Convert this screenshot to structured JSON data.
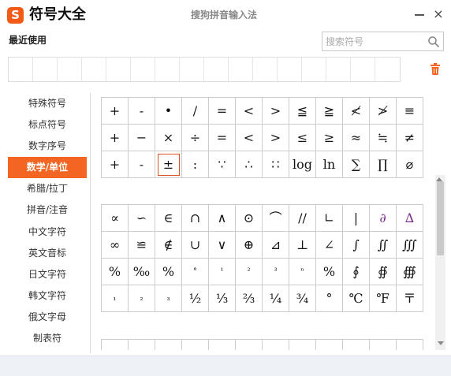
{
  "window": {
    "logo_glyph": "S",
    "title": "符号大全",
    "ime_title": "搜狗拼音输入法",
    "close_glyph": "×"
  },
  "recent": {
    "label": "最近使用",
    "slot_count": 16
  },
  "search": {
    "placeholder": "搜索符号"
  },
  "sidebar": {
    "items": [
      {
        "label": "特殊符号"
      },
      {
        "label": "标点符号"
      },
      {
        "label": "数字序号"
      },
      {
        "label": "数学/单位",
        "active": true
      },
      {
        "label": "希腊/拉丁"
      },
      {
        "label": "拼音/注音"
      },
      {
        "label": "中文字符"
      },
      {
        "label": "英文音标"
      },
      {
        "label": "日文字符"
      },
      {
        "label": "韩文字符"
      },
      {
        "label": "俄文字母"
      },
      {
        "label": "制表符"
      }
    ]
  },
  "grid1": [
    [
      "+",
      "-",
      "•",
      "/",
      "=",
      "<",
      ">",
      "≦",
      "≧",
      "≮",
      "≯",
      "≡"
    ],
    [
      "+",
      "−",
      "×",
      "÷",
      "=",
      "<",
      ">",
      "≤",
      "≥",
      "≈",
      "≒",
      "≠"
    ],
    [
      "+",
      "-",
      "±",
      ":",
      "∵",
      "∴",
      "∷",
      "log",
      "ln",
      "∑",
      "∏",
      "⌀"
    ]
  ],
  "selected": {
    "row": 2,
    "col": 2
  },
  "grid2": [
    [
      "∝",
      "∽",
      "∈",
      "∩",
      "∧",
      "⊙",
      "⌒",
      "//",
      "∟",
      "|",
      "∂",
      "∆"
    ],
    [
      "∞",
      "≌",
      "∉",
      "∪",
      "∨",
      "⊕",
      "⊿",
      "⊥",
      "∠",
      "∫",
      "∬",
      "∭"
    ],
    [
      "%",
      "‰",
      "%",
      "°",
      "¹",
      "²",
      "³",
      "ⁿ",
      "%",
      "∮",
      "∯",
      "∰"
    ],
    [
      "₁",
      "₂",
      "₃",
      "½",
      "⅓",
      "⅔",
      "¼",
      "¾",
      "°",
      "℃",
      "℉",
      "〒"
    ]
  ],
  "grid3": [
    [
      "",
      "",
      "",
      "",
      "",
      "",
      "",
      "",
      "",
      "",
      "",
      ""
    ]
  ],
  "colors": {
    "accent": "#f26522",
    "logo": "#f25a17",
    "purple_symbol": "#7b2d8f"
  }
}
